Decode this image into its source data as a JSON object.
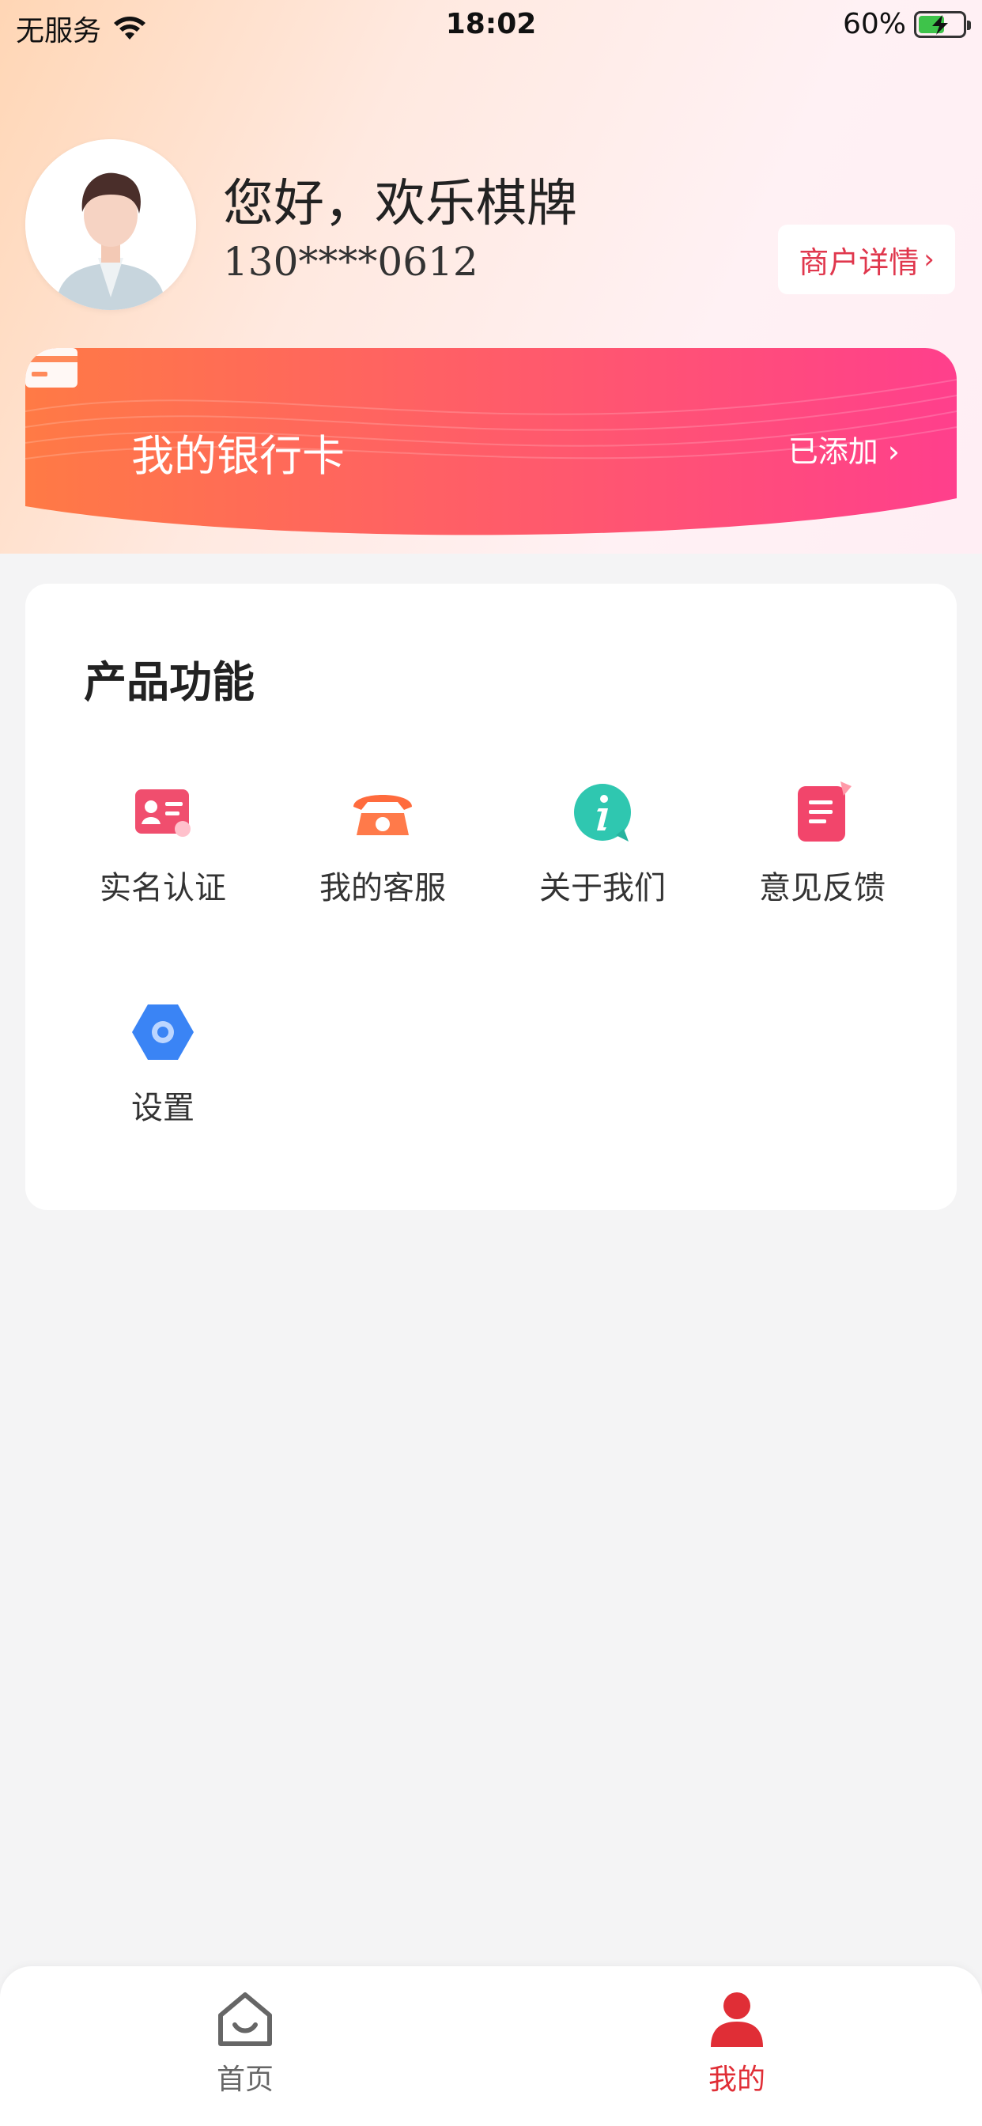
{
  "status_bar": {
    "carrier": "无服务",
    "time": "18:02",
    "battery_percent": "60%",
    "battery_level": 0.6
  },
  "profile": {
    "greeting": "您好，欢乐棋牌",
    "phone": "130****0612",
    "merchant_button": "商户详情",
    "avatar_icon": "user-avatar-icon"
  },
  "bank_card": {
    "title": "我的银行卡",
    "status": "已添加",
    "icon": "bank-card-icon",
    "colors": {
      "start": "#ff7a45",
      "end": "#ff3f8c"
    }
  },
  "features": {
    "title": "产品功能",
    "items": [
      {
        "label": "实名认证",
        "icon": "id-card-icon",
        "color": "#f04e6e"
      },
      {
        "label": "我的客服",
        "icon": "telephone-icon",
        "color": "#ff6b3d"
      },
      {
        "label": "关于我们",
        "icon": "info-icon",
        "color": "#2fc7b0"
      },
      {
        "label": "意见反馈",
        "icon": "feedback-note-icon",
        "color": "#f2456b"
      },
      {
        "label": "设置",
        "icon": "settings-hexagon-icon",
        "color": "#3a84f5"
      }
    ]
  },
  "tabbar": {
    "items": [
      {
        "label": "首页",
        "icon": "home-icon",
        "active": false
      },
      {
        "label": "我的",
        "icon": "user-icon",
        "active": true
      }
    ],
    "active_color": "#e02e36"
  }
}
